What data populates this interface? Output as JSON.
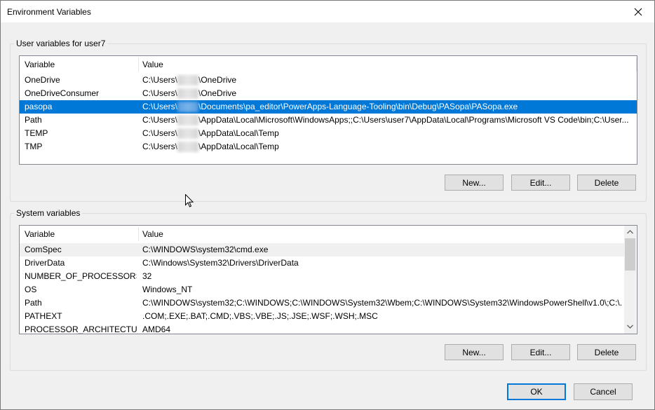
{
  "window": {
    "title": "Environment Variables"
  },
  "user_group": {
    "label": "User variables for user7",
    "columns": [
      "Variable",
      "Value"
    ],
    "rows": [
      {
        "variable": "OneDrive",
        "prefix": "C:\\Users\\",
        "suffix": "\\OneDrive",
        "selected": false
      },
      {
        "variable": "OneDriveConsumer",
        "prefix": "C:\\Users\\",
        "suffix": "\\OneDrive",
        "selected": false
      },
      {
        "variable": "pasopa",
        "prefix": "C:\\Users\\",
        "suffix": "\\Documents\\pa_editor\\PowerApps-Language-Tooling\\bin\\Debug\\PASopa\\PASopa.exe",
        "selected": true
      },
      {
        "variable": "Path",
        "prefix": "C:\\Users\\",
        "suffix": "\\AppData\\Local\\Microsoft\\WindowsApps;;C:\\Users\\user7\\AppData\\Local\\Programs\\Microsoft VS Code\\bin;C:\\User...",
        "selected": false
      },
      {
        "variable": "TEMP",
        "prefix": "C:\\Users\\",
        "suffix": "\\AppData\\Local\\Temp",
        "selected": false
      },
      {
        "variable": "TMP",
        "prefix": "C:\\Users\\",
        "suffix": "\\AppData\\Local\\Temp",
        "selected": false
      }
    ],
    "buttons": {
      "new": "New...",
      "edit": "Edit...",
      "delete": "Delete"
    }
  },
  "system_group": {
    "label": "System variables",
    "columns": [
      "Variable",
      "Value"
    ],
    "rows": [
      {
        "variable": "ComSpec",
        "value": "C:\\WINDOWS\\system32\\cmd.exe",
        "shaded": true
      },
      {
        "variable": "DriverData",
        "value": "C:\\Windows\\System32\\Drivers\\DriverData",
        "shaded": false
      },
      {
        "variable": "NUMBER_OF_PROCESSORS",
        "value": "32",
        "shaded": false
      },
      {
        "variable": "OS",
        "value": "Windows_NT",
        "shaded": false
      },
      {
        "variable": "Path",
        "value": "C:\\WINDOWS\\system32;C:\\WINDOWS;C:\\WINDOWS\\System32\\Wbem;C:\\WINDOWS\\System32\\WindowsPowerShell\\v1.0\\;C:\\...",
        "shaded": false
      },
      {
        "variable": "PATHEXT",
        "value": ".COM;.EXE;.BAT;.CMD;.VBS;.VBE;.JS;.JSE;.WSF;.WSH;.MSC",
        "shaded": false
      },
      {
        "variable": "PROCESSOR_ARCHITECTURE",
        "value": "AMD64",
        "shaded": false
      }
    ],
    "buttons": {
      "new": "New...",
      "edit": "Edit...",
      "delete": "Delete"
    }
  },
  "footer": {
    "ok": "OK",
    "cancel": "Cancel"
  },
  "colors": {
    "selection": "#0078d7",
    "accent": "#0078d7"
  },
  "icons": {
    "close": "close-icon",
    "scroll_up": "chevron-up-icon",
    "scroll_down": "chevron-down-icon",
    "cursor": "mouse-pointer-icon"
  }
}
